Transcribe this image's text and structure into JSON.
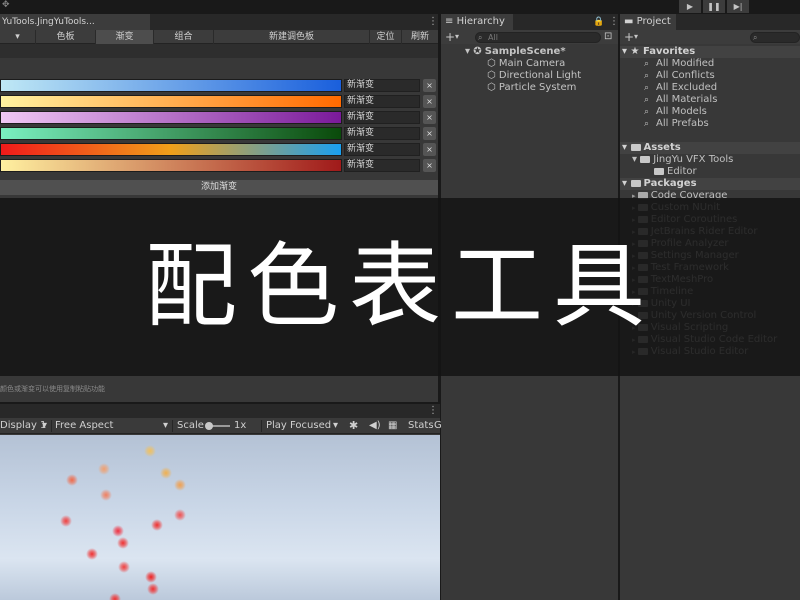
{
  "overlay": {
    "title": "配色表工具"
  },
  "toolbar": {
    "play": "▶",
    "pause": "❚❚",
    "step": "▶|"
  },
  "editor": {
    "tab": "YuTools.JingYuTools...",
    "top_items": [
      "色板",
      "渐变",
      "组合",
      "新建调色板",
      "定位",
      "刷新"
    ],
    "gradients": [
      {
        "name": "新渐变",
        "stops": [
          "#bfe8f5",
          "#1a5fdc"
        ]
      },
      {
        "name": "新渐变",
        "stops": [
          "#fff2a0",
          "#ff6a00"
        ]
      },
      {
        "name": "新渐变",
        "stops": [
          "#f0c8f5",
          "#7a1a9a"
        ]
      },
      {
        "name": "新渐变",
        "stops": [
          "#7af0c0",
          "#0a4a0a"
        ]
      },
      {
        "name": "新渐变",
        "stops": [
          "#f01a1a",
          "#f0a01a",
          "#1aa0f0"
        ]
      },
      {
        "name": "新渐变",
        "stops": [
          "#fff0a0",
          "#a01a1a"
        ]
      }
    ],
    "remove_label": "×",
    "add_gradient": "添加渐变",
    "hint": "颜色或渐变可以使用复制粘贴功能"
  },
  "game": {
    "display": "Display 1",
    "aspect": "Free Aspect",
    "scale_label": "Scale",
    "scale_value": "1x",
    "play_mode": "Play Focused",
    "stats": "Stats",
    "gizmos": "G"
  },
  "hierarchy": {
    "tab": "Hierarchy",
    "search_placeholder": "All",
    "scene": "SampleScene*",
    "items": [
      "Main Camera",
      "Directional Light",
      "Particle System"
    ]
  },
  "project": {
    "tab": "Project",
    "favorites_header": "Favorites",
    "favorites": [
      "All Modified",
      "All Conflicts",
      "All Excluded",
      "All Materials",
      "All Models",
      "All Prefabs"
    ],
    "assets_header": "Assets",
    "assets": [
      "JingYu VFX Tools",
      "Editor"
    ],
    "packages_header": "Packages",
    "packages": [
      "Code Coverage",
      "Custom NUnit",
      "Editor Coroutines",
      "JetBrains Rider Editor",
      "Profile Analyzer",
      "Settings Manager",
      "Test Framework",
      "TextMeshPro",
      "Timeline",
      "Unity UI",
      "Unity Version Control",
      "Visual Scripting",
      "Visual Studio Code Editor",
      "Visual Studio Editor"
    ]
  },
  "colors": {
    "background": "#191919",
    "panel": "#383838",
    "accent": "#1a5fdc"
  }
}
